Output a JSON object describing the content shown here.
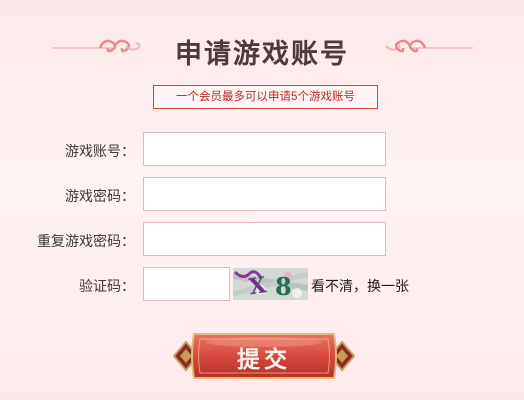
{
  "header": {
    "title": "申请游戏账号",
    "notice": "一个会员最多可以申请5个游戏账号"
  },
  "form": {
    "account_label": "游戏账号：",
    "password_label": "游戏密码：",
    "confirm_label": "重复游戏密码：",
    "captcha_label": "验证码：",
    "account_value": "",
    "password_value": "",
    "confirm_value": "",
    "captcha_value": "",
    "captcha_text": "X8",
    "refresh_text": "看不清，换一张"
  },
  "actions": {
    "submit_label": "提交"
  },
  "colors": {
    "accent_red": "#d9443d",
    "title_text": "#4c3b3b",
    "field_border": "#e2b9bd",
    "button_gold": "#c99a5a"
  },
  "icons": {
    "left_ornament": "cloud-scroll-ornament-icon",
    "right_ornament": "cloud-scroll-ornament-icon",
    "button_ornament": "diamond-ornament-icon"
  }
}
